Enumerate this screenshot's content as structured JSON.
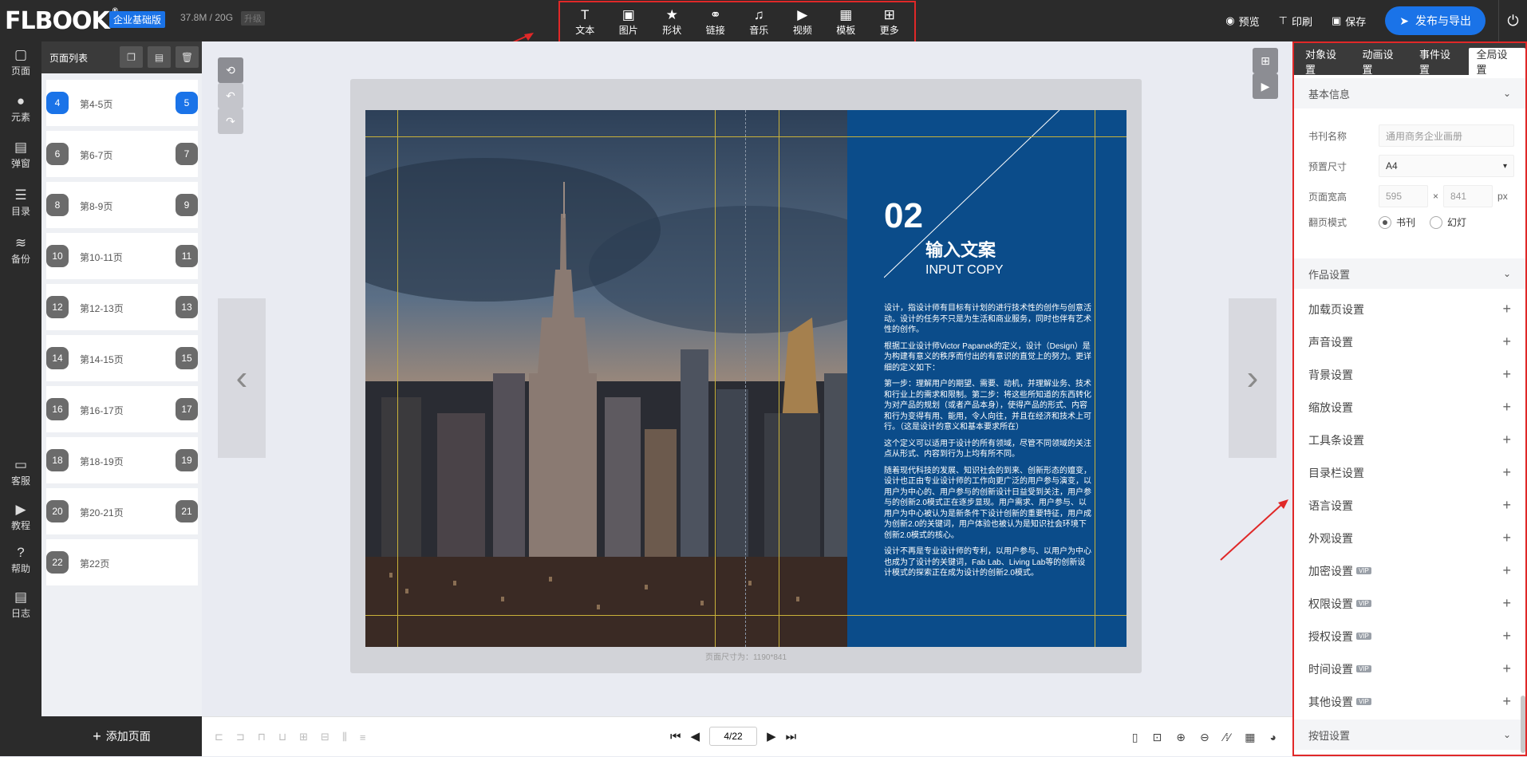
{
  "app": {
    "logo": "FLBOOK",
    "logo_mark": "®",
    "edition": "企业基础版",
    "storage": "37.8M / 20G",
    "upgrade": "升级"
  },
  "toolbar": {
    "tools": [
      {
        "label": "文本",
        "icon": "text-icon",
        "glyph": "T"
      },
      {
        "label": "图片",
        "icon": "image-icon",
        "glyph": "▣"
      },
      {
        "label": "形状",
        "icon": "star-icon",
        "glyph": "★"
      },
      {
        "label": "链接",
        "icon": "link-icon",
        "glyph": "⚭"
      },
      {
        "label": "音乐",
        "icon": "music-icon",
        "glyph": "♫"
      },
      {
        "label": "视频",
        "icon": "play-circle-icon",
        "glyph": "▶"
      },
      {
        "label": "模板",
        "icon": "template-icon",
        "glyph": "▦"
      },
      {
        "label": "更多",
        "icon": "more-icon",
        "glyph": "⊞"
      }
    ]
  },
  "topright": {
    "preview": "预览",
    "print": "印刷",
    "save": "保存",
    "publish": "发布与导出"
  },
  "leftnav": [
    {
      "label": "页面",
      "icon": "page-icon",
      "glyph": "▢"
    },
    {
      "label": "元素",
      "icon": "elements-icon",
      "glyph": "●"
    },
    {
      "label": "弹窗",
      "icon": "popup-icon",
      "glyph": "▤"
    },
    {
      "label": "目录",
      "icon": "toc-icon",
      "glyph": "☰"
    },
    {
      "label": "备份",
      "icon": "backup-icon",
      "glyph": "≋"
    },
    {
      "label": "客服",
      "icon": "chat-icon",
      "glyph": "▭"
    },
    {
      "label": "教程",
      "icon": "tutorial-icon",
      "glyph": "▶"
    },
    {
      "label": "帮助",
      "icon": "help-icon",
      "glyph": "?"
    },
    {
      "label": "日志",
      "icon": "log-icon",
      "glyph": "▤"
    }
  ],
  "pagelist": {
    "title": "页面列表",
    "spreads": [
      {
        "left": "4",
        "right": "5",
        "label": "第4-5页",
        "active": true
      },
      {
        "left": "6",
        "right": "7",
        "label": "第6-7页"
      },
      {
        "left": "8",
        "right": "9",
        "label": "第8-9页"
      },
      {
        "left": "10",
        "right": "11",
        "label": "第10-11页"
      },
      {
        "left": "12",
        "right": "13",
        "label": "第12-13页"
      },
      {
        "left": "14",
        "right": "15",
        "label": "第14-15页"
      },
      {
        "left": "16",
        "right": "17",
        "label": "第16-17页"
      },
      {
        "left": "18",
        "right": "19",
        "label": "第18-19页"
      },
      {
        "left": "20",
        "right": "21",
        "label": "第20-21页"
      },
      {
        "left": "22",
        "right": "",
        "label": "第22页"
      }
    ],
    "add_page": "添加页面"
  },
  "canvas": {
    "page_number_big": "02",
    "title_cn": "输入文案",
    "title_en": "INPUT COPY",
    "body": [
      "设计，指设计师有目标有计划的进行技术性的创作与创意活动。设计的任务不只是为生活和商业服务，同时也伴有艺术性的创作。",
      "根据工业设计师Victor Papanek的定义，设计（Design）是为构建有意义的秩序而付出的有意识的直觉上的努力。更详细的定义如下：",
      "第一步：理解用户的期望、需要、动机，并理解业务、技术和行业上的需求和限制。第二步：将这些所知道的东西转化为对产品的规划（或者产品本身），使得产品的形式、内容和行为变得有用、能用，令人向往，并且在经济和技术上可行。（这是设计的意义和基本要求所在）",
      "这个定义可以适用于设计的所有领域，尽管不同领域的关注点从形式、内容到行为上均有所不同。",
      "随着现代科技的发展、知识社会的到来、创新形态的嬗变，设计也正由专业设计师的工作向更广泛的用户参与演变，以用户为中心的、用户参与的创新设计日益受到关注，用户参与的创新2.0模式正在逐步显现。用户需求、用户参与、以用户为中心被认为是新条件下设计创新的重要特征，用户成为创新2.0的关键词，用户体验也被认为是知识社会环境下创新2.0模式的核心。",
      "设计不再是专业设计师的专利，以用户参与、以用户为中心也成为了设计的关键词，Fab Lab、Living Lab等的创新设计模式的探索正在成为设计的创新2.0模式。"
    ],
    "page_size": "页面尺寸为：1190*841"
  },
  "pager": {
    "current": "4/22"
  },
  "rightpanel": {
    "tabs": [
      {
        "label": "对象设置"
      },
      {
        "label": "动画设置"
      },
      {
        "label": "事件设置"
      },
      {
        "label": "全局设置",
        "active": true
      }
    ],
    "basic_info": {
      "title": "基本信息",
      "name_label": "书刊名称",
      "name_placeholder": "通用商务企业画册",
      "preset_label": "预置尺寸",
      "preset_value": "A4",
      "size_label": "页面宽高",
      "width": "595",
      "times": "×",
      "height": "841",
      "unit": "px",
      "flip_label": "翻页模式",
      "flip_book": "书刊",
      "flip_slide": "幻灯"
    },
    "work_settings_title": "作品设置",
    "settings": [
      {
        "label": "加载页设置"
      },
      {
        "label": "声音设置"
      },
      {
        "label": "背景设置"
      },
      {
        "label": "缩放设置"
      },
      {
        "label": "工具条设置"
      },
      {
        "label": "目录栏设置"
      },
      {
        "label": "语言设置"
      },
      {
        "label": "外观设置"
      },
      {
        "label": "加密设置",
        "vip": "VIP"
      },
      {
        "label": "权限设置",
        "vip": "VIP"
      },
      {
        "label": "授权设置",
        "vip": "VIP"
      },
      {
        "label": "时间设置",
        "vip": "VIP"
      },
      {
        "label": "其他设置",
        "vip": "VIP"
      }
    ],
    "button_settings_title": "按钮设置"
  },
  "colors": {
    "accent": "#1a73e8",
    "topbar": "#2b2b2b",
    "highlight_border": "#e02828",
    "page_blue": "#0b4c8a"
  }
}
